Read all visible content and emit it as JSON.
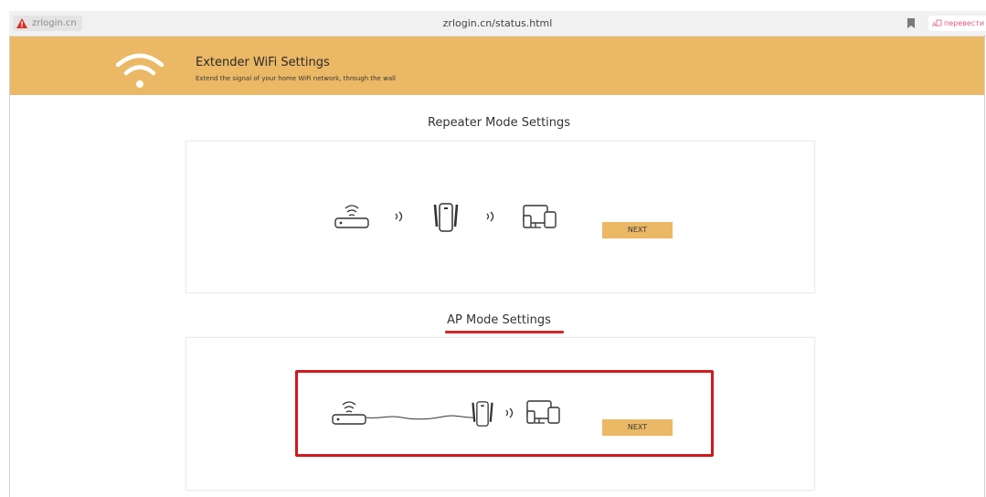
{
  "browser": {
    "site_chip": "zrlogin.cn",
    "url": "zrlogin.cn/status.html",
    "translate_label": "перевести"
  },
  "header": {
    "title": "Extender WiFi Settings",
    "subtitle": "Extend the signal of your home WiFi network, through the wall"
  },
  "repeater": {
    "title": "Repeater Mode Settings",
    "next_label": "NEXT"
  },
  "ap": {
    "title": "AP Mode Settings",
    "next_label": "NEXT"
  },
  "colors": {
    "header_bg": "#ebb865",
    "button_bg": "#ebb865",
    "annotation_red": "#cf1a1f"
  },
  "icons": [
    "warning-icon",
    "bookmark-icon",
    "translate-icon",
    "wifi-logo-icon",
    "router-icon",
    "signal-waves-icon",
    "extender-icon",
    "devices-icon"
  ]
}
